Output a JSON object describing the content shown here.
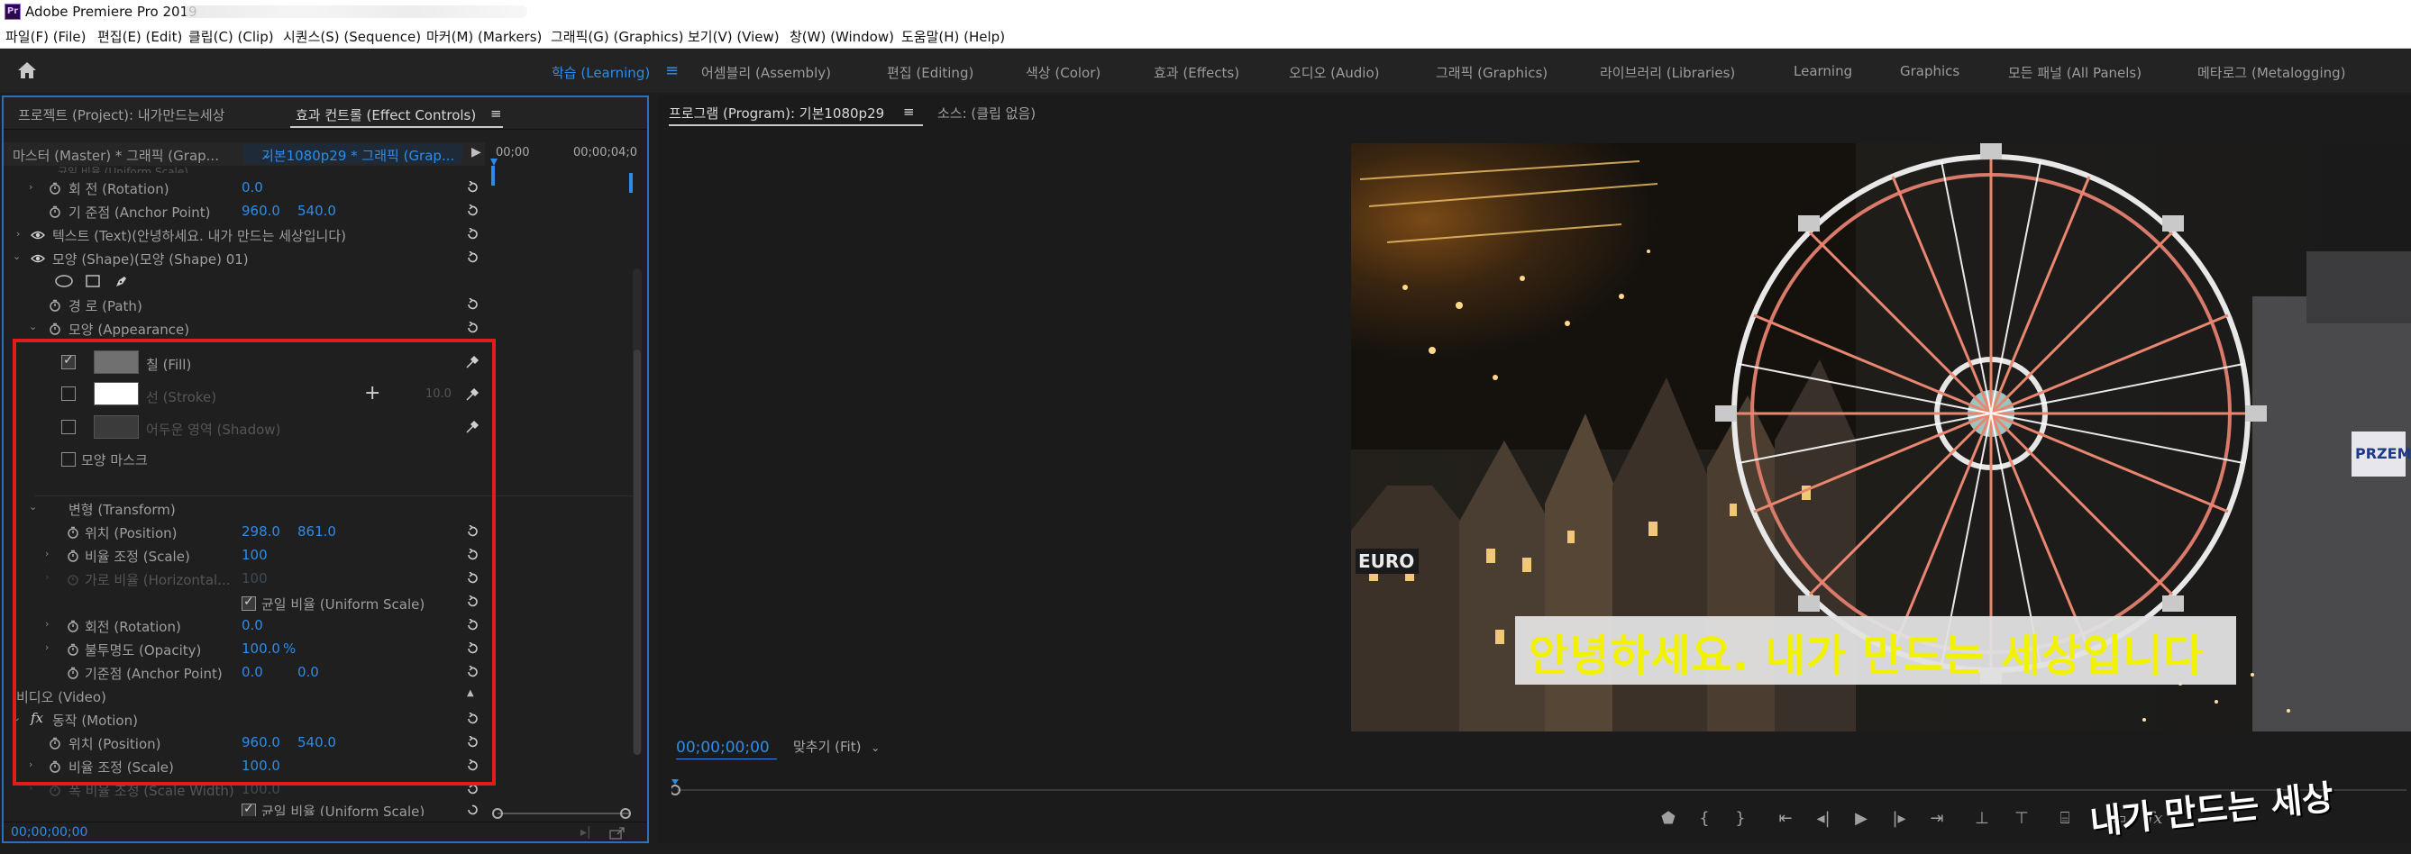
{
  "window": {
    "title": "Adobe Premiere Pro 2019",
    "logo": "Pr"
  },
  "menu": [
    "파일(F) (File)",
    "편집(E) (Edit)",
    "클립(C) (Clip)",
    "시퀀스(S) (Sequence)",
    "마커(M) (Markers)",
    "그래픽(G) (Graphics)",
    "보기(V) (View)",
    "창(W) (Window)",
    "도움말(H) (Help)"
  ],
  "workspaces": [
    "학습 (Learning)",
    "어셈블리 (Assembly)",
    "편집 (Editing)",
    "색상 (Color)",
    "효과 (Effects)",
    "오디오 (Audio)",
    "그래픽 (Graphics)",
    "라이브러리 (Libraries)",
    "Learning",
    "Graphics",
    "모든 패널 (All Panels)",
    "메타로그 (Metalogging)"
  ],
  "left_panel": {
    "tabs": [
      "프로젝트 (Project): 내가만드는세상",
      "효과 컨트롤 (Effect Controls)"
    ],
    "menu_icon": "≡",
    "master": "마스터 (Master) * 그래픽 (Grap...",
    "sequence": "기본1080p29 * 그래픽 (Grap...",
    "ruler": [
      "00;00",
      "00;00;04;0"
    ],
    "rows": {
      "partial_top": "균일 비율 (Uniform Scale)",
      "rotation": {
        "label": "회 전 (Rotation)",
        "value": "0.0"
      },
      "anchor": {
        "label": "기 준점 (Anchor Point)",
        "x": "960.0",
        "y": "540.0"
      },
      "text_layer": "텍스트 (Text)(안녕하세요. 내가 만드는 세상입니다)",
      "shape_layer": "모양 (Shape)(모양 (Shape) 01)",
      "path": "경 로 (Path)",
      "appearance": "모양 (Appearance)",
      "fill": "칠 (Fill)",
      "stroke": "선 (Stroke)",
      "stroke_width": "10.0",
      "shadow": "어두운 영역 (Shadow)",
      "shape_mask": "모양 마스크",
      "transform": "변형 (Transform)",
      "t_position": {
        "label": "위치 (Position)",
        "x": "298.0",
        "y": "861.0"
      },
      "t_scale": {
        "label": "비율 조정 (Scale)",
        "value": "100"
      },
      "t_scale_h": {
        "label": "가로 비율 (Horizontal...",
        "value": "100"
      },
      "t_uniform": "균일 비율 (Uniform Scale)",
      "t_rotation": {
        "label": "회전 (Rotation)",
        "value": "0.0"
      },
      "t_opacity": {
        "label": "불투명도 (Opacity)",
        "value": "100.0",
        "unit": "%"
      },
      "t_anchor": {
        "label": "기준점 (Anchor Point)",
        "x": "0.0",
        "y": "0.0"
      },
      "video": "비디오 (Video)",
      "motion": "동작 (Motion)",
      "m_position": {
        "label": "위치 (Position)",
        "x": "960.0",
        "y": "540.0"
      },
      "m_scale": {
        "label": "비율 조정 (Scale)",
        "value": "100.0"
      },
      "m_scale_w": {
        "label": "폭 비율 조정 (Scale Width)",
        "value": "100.0"
      },
      "m_uniform": "균일 비율 (Uniform Scale)"
    },
    "timecode": "00;00;00;00"
  },
  "program": {
    "tabs": [
      "프로그램 (Program): 기본1080p29",
      "소스: (클립 없음)"
    ],
    "menu_icon": "≡",
    "subtitle": "안녕하세요. 내가 만드는 세상입니다",
    "sign_text": "PRZEM",
    "sign_text2": "EURO",
    "timecode": "00;00;00;00",
    "fit": "맞추기 (Fit)",
    "watermark": "내가 만드는 세상"
  },
  "colors": {
    "accent": "#2d8ceb",
    "highlight_box": "#e21b1b",
    "subtitle_text": "#f2f200",
    "subtitle_bg": "#e1e1e1"
  }
}
